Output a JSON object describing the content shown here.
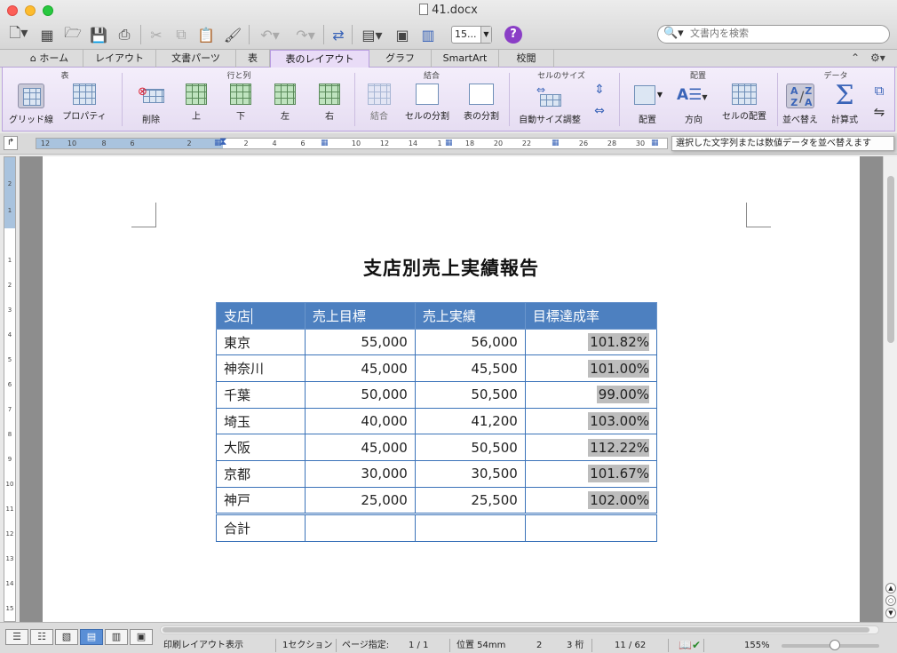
{
  "window": {
    "title": "41.docx"
  },
  "toolbar": {
    "zoom_value": "15...",
    "search_placeholder": "文書内を検索",
    "help_label": "?"
  },
  "tabs": [
    {
      "label": "ホーム"
    },
    {
      "label": "レイアウト"
    },
    {
      "label": "文書パーツ"
    },
    {
      "label": "表"
    },
    {
      "label": "表のレイアウト"
    },
    {
      "label": "グラフ"
    },
    {
      "label": "SmartArt"
    },
    {
      "label": "校閲"
    }
  ],
  "ribbon": {
    "groups": {
      "table": "表",
      "rows_cols": "行と列",
      "merge": "結合",
      "cell_size": "セルのサイズ",
      "alignment": "配置",
      "data": "データ"
    },
    "buttons": {
      "gridlines": "グリッド線",
      "properties": "プロパティ",
      "delete": "削除",
      "above": "上",
      "below": "下",
      "left": "左",
      "right": "右",
      "merge": "結合",
      "split_cells": "セルの分割",
      "split_table": "表の分割",
      "autofit": "自動サイズ調整",
      "align": "配置",
      "direction": "方向",
      "cell_margins": "セルの配置",
      "sort": "並べ替え",
      "formula": "計算式"
    }
  },
  "tooltip": "選択した文字列または数値データを並べ替えます",
  "ruler": {
    "h_ticks": [
      "12",
      "10",
      "8",
      "6",
      "2",
      "2",
      "4",
      "6",
      "10",
      "12",
      "14",
      "1",
      "18",
      "20",
      "22",
      "26",
      "28",
      "30"
    ],
    "v_ticks": [
      "2",
      "1",
      "1",
      "2",
      "3",
      "4",
      "5",
      "6",
      "7",
      "8",
      "9",
      "10",
      "11",
      "12",
      "13",
      "14",
      "15"
    ]
  },
  "document": {
    "title": "支店別売上実績報告",
    "headers": [
      "支店",
      "売上目標",
      "売上実績",
      "目標達成率"
    ],
    "rows": [
      [
        "東京",
        "55,000",
        "56,000",
        "101.82%"
      ],
      [
        "神奈川",
        "45,000",
        "45,500",
        "101.00%"
      ],
      [
        "千葉",
        "50,000",
        "50,500",
        "99.00%"
      ],
      [
        "埼玉",
        "40,000",
        "41,200",
        "103.00%"
      ],
      [
        "大阪",
        "45,000",
        "50,500",
        "112.22%"
      ],
      [
        "京都",
        "30,000",
        "30,500",
        "101.67%"
      ],
      [
        "神戸",
        "25,000",
        "25,500",
        "102.00%"
      ]
    ],
    "total_label": "合計"
  },
  "status": {
    "view": "印刷レイアウト表示",
    "section": "1セクション",
    "page_label": "ページ指定:",
    "page_value": "1 / 1",
    "position": "位置 54mm",
    "line": "2",
    "column": "3 桁",
    "words": "11 / 62",
    "zoom": "155%",
    "zoom_level": 0.55
  }
}
